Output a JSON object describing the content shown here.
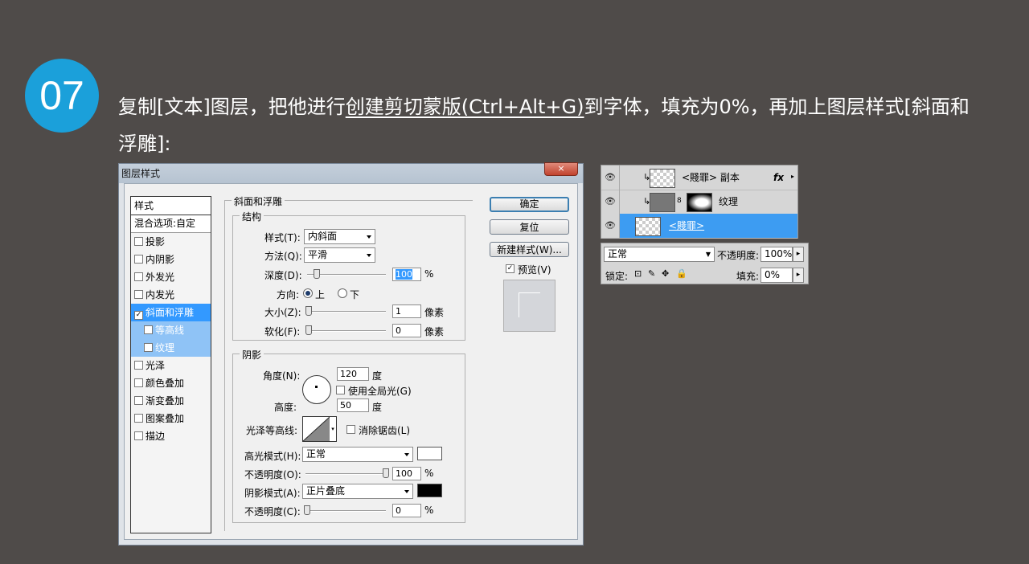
{
  "step": {
    "number": "07"
  },
  "instruction": {
    "part1": "复制[文本]图层，把他进行",
    "link": "创建剪切蒙版(Ctrl+Alt+G)",
    "part2": "到字体，填充为0%，再加上图层样式[斜面和浮雕]:"
  },
  "dialog": {
    "title": "图层样式",
    "close_label": "×",
    "styles": {
      "header": "样式",
      "blending": "混合选项:自定",
      "items": [
        {
          "label": "投影",
          "checked": false
        },
        {
          "label": "内阴影",
          "checked": false
        },
        {
          "label": "外发光",
          "checked": false
        },
        {
          "label": "内发光",
          "checked": false
        },
        {
          "label": "斜面和浮雕",
          "checked": true,
          "selected": true
        },
        {
          "label": "等高线",
          "checked": false,
          "sub": true
        },
        {
          "label": "纹理",
          "checked": false,
          "sub": true
        },
        {
          "label": "光泽",
          "checked": false
        },
        {
          "label": "颜色叠加",
          "checked": false
        },
        {
          "label": "渐变叠加",
          "checked": false
        },
        {
          "label": "图案叠加",
          "checked": false
        },
        {
          "label": "描边",
          "checked": false
        }
      ]
    },
    "bevel": {
      "section_title": "斜面和浮雕",
      "structure_title": "结构",
      "style_label": "样式(T):",
      "style_value": "内斜面",
      "technique_label": "方法(Q):",
      "technique_value": "平滑",
      "depth_label": "深度(D):",
      "depth_value": "100",
      "depth_unit": "%",
      "direction_label": "方向:",
      "direction_up": "上",
      "direction_down": "下",
      "size_label": "大小(Z):",
      "size_value": "1",
      "size_unit": "像素",
      "soften_label": "软化(F):",
      "soften_value": "0",
      "soften_unit": "像素"
    },
    "shading": {
      "title": "阴影",
      "angle_label": "角度(N):",
      "angle_value": "120",
      "angle_unit": "度",
      "global_light_label": "使用全局光(G)",
      "altitude_label": "高度:",
      "altitude_value": "50",
      "altitude_unit": "度",
      "gloss_contour_label": "光泽等高线:",
      "antialias_label": "消除锯齿(L)",
      "highlight_mode_label": "高光模式(H):",
      "highlight_mode_value": "正常",
      "highlight_color": "#ffffff",
      "highlight_opacity_label": "不透明度(O):",
      "highlight_opacity_value": "100",
      "highlight_opacity_unit": "%",
      "shadow_mode_label": "阴影模式(A):",
      "shadow_mode_value": "正片叠底",
      "shadow_color": "#000000",
      "shadow_opacity_label": "不透明度(C):",
      "shadow_opacity_value": "0",
      "shadow_opacity_unit": "%"
    },
    "buttons": {
      "ok": "确定",
      "reset": "复位",
      "new_style": "新建样式(W)...",
      "preview": "预览(V)"
    }
  },
  "layers_panel": {
    "layers": [
      {
        "name": "<賤罪> 副本",
        "fx": "fx",
        "active": false
      },
      {
        "name": "纹理",
        "active": false
      },
      {
        "name": "<賤罪>",
        "active": true
      }
    ],
    "blend_mode": "正常",
    "opacity_label": "不透明度:",
    "opacity_value": "100%",
    "lock_label": "锁定:",
    "fill_label": "填充:",
    "fill_value": "0%"
  }
}
